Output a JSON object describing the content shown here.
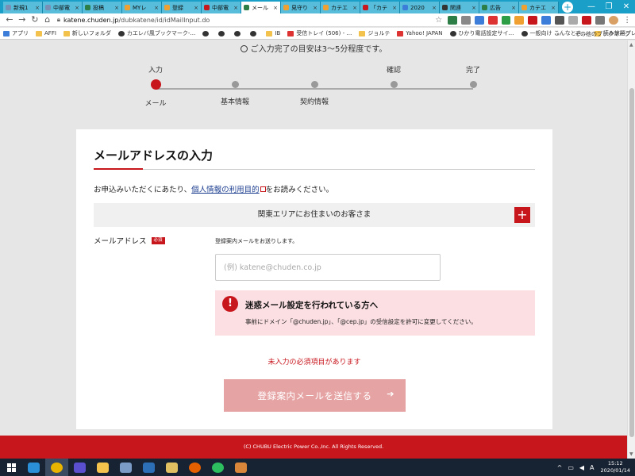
{
  "browser": {
    "tabs": [
      {
        "title": "新規1",
        "color": "#7b8fb5",
        "active": false
      },
      {
        "title": "中部電",
        "color": "#7b8fb5",
        "active": false
      },
      {
        "title": "投稿",
        "color": "#2d7d46",
        "active": false
      },
      {
        "title": "MYレ",
        "color": "#f0a030",
        "active": false
      },
      {
        "title": "登録",
        "color": "#f0a030",
        "active": false
      },
      {
        "title": "中部電",
        "color": "#c8161d",
        "active": false
      },
      {
        "title": "メール",
        "color": "#2d7d46",
        "active": true
      },
      {
        "title": "見守り",
        "color": "#f0a030",
        "active": false
      },
      {
        "title": "カテエ",
        "color": "#f0a030",
        "active": false
      },
      {
        "title": "「カテ",
        "color": "#c8161d",
        "active": false
      },
      {
        "title": "2020",
        "color": "#3b7dd8",
        "active": false
      },
      {
        "title": "関連",
        "color": "#333333",
        "active": false
      },
      {
        "title": "広告",
        "color": "#2d7d46",
        "active": false
      },
      {
        "title": "カテエ",
        "color": "#f0a030",
        "active": false
      }
    ],
    "new_tab": "+",
    "url_host": "katene.chuden.jp",
    "url_path": "/dubkatene/id/idMailInput.do",
    "bookmarks": [
      {
        "label": "アプリ",
        "icon": "grid"
      },
      {
        "label": "AFFI",
        "icon": "folder"
      },
      {
        "label": "新しいフォルダ",
        "icon": "folder"
      },
      {
        "label": "カエレバ風ブックマーク-…",
        "icon": "globe"
      },
      {
        "label": "",
        "icon": "globe"
      },
      {
        "label": "",
        "icon": "globe"
      },
      {
        "label": "",
        "icon": "globe"
      },
      {
        "label": "",
        "icon": "globe"
      },
      {
        "label": "IB",
        "icon": "folder"
      },
      {
        "label": "受信トレイ (506) - …",
        "icon": "red"
      },
      {
        "label": "ジョルテ",
        "icon": "folder"
      },
      {
        "label": "Yahoo! JAPAN",
        "icon": "red"
      },
      {
        "label": "ひかり電話設定サイ…",
        "icon": "globe"
      },
      {
        "label": "一般向け こんなとき…",
        "icon": "globe"
      },
      {
        "label": "読み放題プレミアム b…",
        "icon": "folder"
      }
    ],
    "bookmarks_more": "»",
    "other_bookmarks": "その他のブックマーク"
  },
  "page": {
    "time_note": "ご入力完了の目安は3～5分程度です。",
    "steps": [
      {
        "top": "入力",
        "bottom": "メール",
        "active": true
      },
      {
        "top": "",
        "bottom": "基本情報",
        "active": false
      },
      {
        "top": "",
        "bottom": "契約情報",
        "active": false
      },
      {
        "top": "確認",
        "bottom": "",
        "active": false
      },
      {
        "top": "完了",
        "bottom": "",
        "active": false
      }
    ],
    "heading": "メールアドレスの入力",
    "intro_before": "お申込みいただくにあたり、",
    "intro_link": "個人情報の利用目的",
    "intro_after": "をお読みください。",
    "region_label": "関東エリアにお住まいのお客さま",
    "region_toggle": "+",
    "email_label": "メールアドレス",
    "required_badge": "必須",
    "email_help": "登録案内メールをお送りします。",
    "email_value": "",
    "email_placeholder": "(例) katene@chuden.co.jp",
    "alert_icon": "!",
    "alert_title": "迷惑メール設定を行われている方へ",
    "alert_body": "事前にドメイン「@chuden.jp」、「@cep.jp」の受信設定を許可に変更してください。",
    "error_text": "未入力の必須項目があります",
    "submit_label": "登録案内メールを送信する",
    "submit_arrow": "➔",
    "footer": "(C) CHUBU Electric Power Co.,Inc. All Rights Reserved."
  },
  "taskbar": {
    "apps": [
      "ie",
      "chrome",
      "settings",
      "explorer",
      "thunderbird",
      "remote",
      "photos",
      "firefox",
      "evernote",
      "orange-app"
    ],
    "time": "15:12",
    "date": "2020/01/14",
    "ime": "A"
  }
}
